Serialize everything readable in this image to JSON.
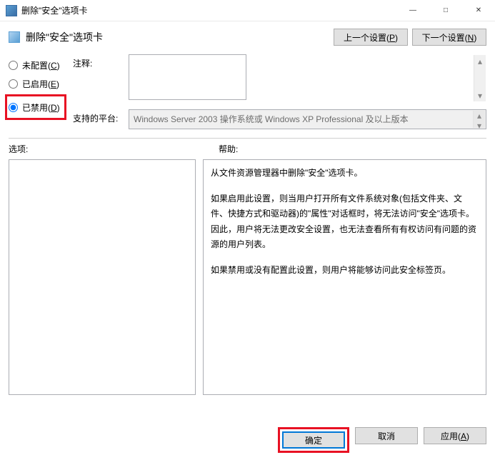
{
  "window": {
    "title": "删除\"安全\"选项卡",
    "minimize": "—",
    "maximize": "□",
    "close": "✕"
  },
  "header": {
    "policy_title": "删除\"安全\"选项卡",
    "prev_label": "上一个设置(P)",
    "next_label": "下一个设置(N)"
  },
  "config": {
    "not_configured": "未配置(C)",
    "enabled": "已启用(E)",
    "disabled": "已禁用(D)",
    "comment_label": "注释:",
    "comment_value": "",
    "platform_label": "支持的平台:",
    "platform_value": "Windows Server 2003 操作系统或 Windows XP Professional 及以上版本"
  },
  "labels": {
    "options": "选项:",
    "help": "帮助:"
  },
  "help": {
    "p1": "从文件资源管理器中删除\"安全\"选项卡。",
    "p2": "如果启用此设置，则当用户打开所有文件系统对象(包括文件夹、文件、快捷方式和驱动器)的\"属性\"对话框时，将无法访问\"安全\"选项卡。因此，用户将无法更改安全设置，也无法查看所有有权访问有问题的资源的用户列表。",
    "p3": "如果禁用或没有配置此设置，则用户将能够访问此安全标签页。"
  },
  "footer": {
    "ok": "确定",
    "cancel": "取消",
    "apply": "应用(A)"
  }
}
